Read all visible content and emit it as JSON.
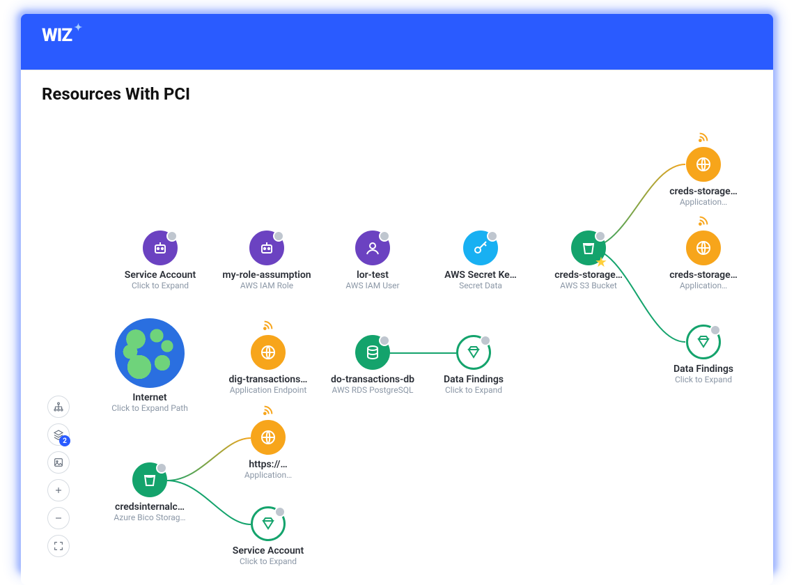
{
  "logo": "WIZ",
  "page_title": "Resources With PCI",
  "toolbar_badge": "2",
  "nodes": {
    "svc1": {
      "label": "Service Account",
      "sub": "Click to Expand"
    },
    "role": {
      "label": "my-role-assumption",
      "sub": "AWS IAM Role"
    },
    "user": {
      "label": "lor-test",
      "sub": "AWS IAM User"
    },
    "secret": {
      "label": "AWS Secret Ke…",
      "sub": "Secret Data"
    },
    "bucket": {
      "label": "creds-storage…",
      "sub": "AWS S3 Bucket"
    },
    "app1": {
      "label": "creds-storage…",
      "sub": "Application…"
    },
    "app2": {
      "label": "creds-storage…",
      "sub": "Application…"
    },
    "find1": {
      "label": "Data Findings",
      "sub": "Click to Expand"
    },
    "net": {
      "label": "Internet",
      "sub": "Click to Expand Path"
    },
    "dig": {
      "label": "dig-transactions…",
      "sub": "Application Endpoint"
    },
    "dodb": {
      "label": "do-transactions-db",
      "sub": "AWS RDS PostgreSQL"
    },
    "find2": {
      "label": "Data Findings",
      "sub": "Click to Expand"
    },
    "azure": {
      "label": "credsinternalc…",
      "sub": "Azure Bico Storag…"
    },
    "https": {
      "label": "https://…",
      "sub": "Application…"
    },
    "svc2": {
      "label": "Service Account",
      "sub": "Click to Expand"
    }
  }
}
